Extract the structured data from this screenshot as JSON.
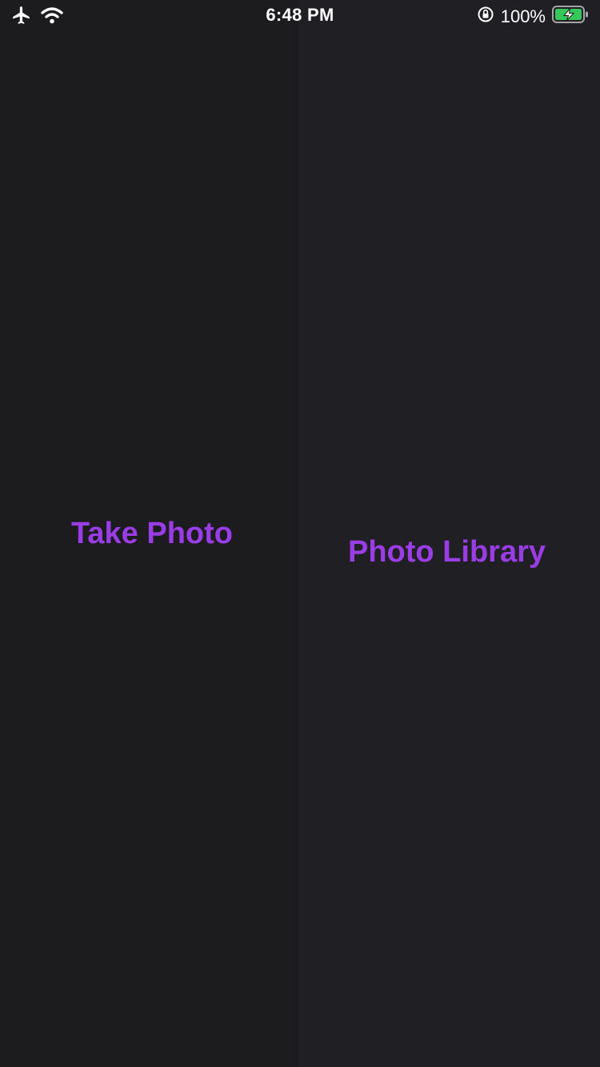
{
  "status_bar": {
    "time": "6:48 PM",
    "battery_percent_label": "100%",
    "battery_level": 1.0,
    "battery_charging": true,
    "icons": [
      "airplane-icon",
      "wifi-icon",
      "rotation-lock-icon",
      "battery-icon"
    ],
    "battery_color": "#34c759"
  },
  "actions": {
    "take_photo_label": "Take Photo",
    "photo_library_label": "Photo Library",
    "accent_color": "#9b3de6"
  },
  "background": {
    "left_color": "#1c1c1e",
    "right_color": "#202024"
  }
}
